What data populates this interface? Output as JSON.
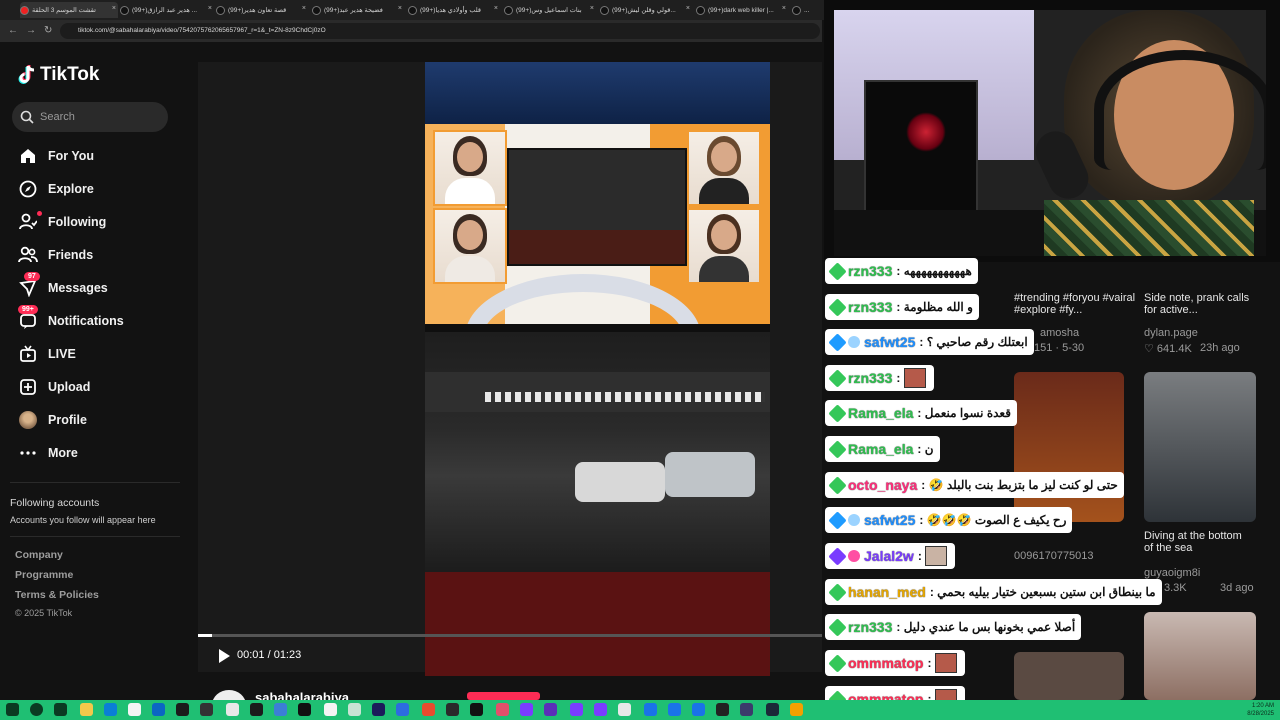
{
  "browser": {
    "tabs": [
      {
        "label": "تقشت الموسم 3 الحلقة"
      },
      {
        "label": "(99+)هدير عبد الرازق ..."
      },
      {
        "label": "(99+)قصة تعاون هدير"
      },
      {
        "label": "(99+)فضيحة هدير عبد"
      },
      {
        "label": "(99+)قلب وأولادي هديا"
      },
      {
        "label": "(99+)بنات اسماعيل وس"
      },
      {
        "label": "(99+)قولي وقلن ليش..."
      },
      {
        "label": "(99+)dark web killer |..."
      },
      {
        "label": "..."
      }
    ],
    "url": "tiktok.com/@sabahalarabiya/video/7542075762065657967_r=1&_t=ZN-8z9ChdCj0zO"
  },
  "tiktok": {
    "logo_text": "TikTok",
    "search_placeholder": "Search",
    "nav": [
      {
        "label": "For You",
        "icon": "home-icon"
      },
      {
        "label": "Explore",
        "icon": "compass-icon"
      },
      {
        "label": "Following",
        "icon": "following-icon"
      },
      {
        "label": "Friends",
        "icon": "friends-icon"
      },
      {
        "label": "Messages",
        "icon": "messages-icon",
        "badge": "97"
      },
      {
        "label": "Notifications",
        "icon": "notifications-icon",
        "badge": "99+"
      },
      {
        "label": "LIVE",
        "icon": "live-icon"
      },
      {
        "label": "Upload",
        "icon": "upload-icon"
      },
      {
        "label": "Profile",
        "icon": "profile-avatar"
      },
      {
        "label": "More",
        "icon": "more-icon"
      }
    ],
    "following_heading": "Following accounts",
    "following_sub": "Accounts you follow will appear here",
    "footer": [
      "Company",
      "Programme",
      "Terms & Policies"
    ],
    "copyright": "© 2025 TikTok",
    "player": {
      "time": "00:01 / 01:23",
      "author": "sabahalarabiya"
    }
  },
  "feed": {
    "cards": [
      {
        "title": "#trending #foryou #vairal #explore #fy...",
        "author": "amosha",
        "meta": "151 · 5-30"
      },
      {
        "title": "Side note, prank calls for active...",
        "author": "dylan.page",
        "likes": "641.4K",
        "age": "23h ago"
      },
      {
        "title": "Diving at the bottom of the sea",
        "author": "guyaoigm8i",
        "likes": "3.3K",
        "age": "3d ago"
      }
    ],
    "phone": "0096170775013"
  },
  "chat": [
    {
      "badge": "green",
      "name": "rzn333",
      "color": "#2fbf4f",
      "text": "هههههههههههه"
    },
    {
      "badge": "green",
      "name": "rzn333",
      "color": "#2fbf4f",
      "text": "و الله مظلومة"
    },
    {
      "badge": "blue",
      "name": "safwt25",
      "color": "#1e8fff",
      "text": "ابعتلك رقم صاحبي ؟"
    },
    {
      "badge": "green",
      "name": "rzn333",
      "color": "#2fbf4f",
      "text": "",
      "image": true
    },
    {
      "badge": "green",
      "name": "Rama_ela",
      "color": "#2fbf4f",
      "text": "قعدة نسوا منعمل"
    },
    {
      "badge": "green",
      "name": "Rama_ela",
      "color": "#2fbf4f",
      "text": "ن"
    },
    {
      "badge": "green",
      "name": "octo_naya",
      "color": "#ff2d7a",
      "text": "حتى لو كنت ليز ما بتزبط بنت بالبلد 🤣"
    },
    {
      "badge": "blue",
      "name": "safwt25",
      "color": "#1e8fff",
      "text": "رح يكيف ع الصوت 🤣🤣🤣"
    },
    {
      "badge": "purple",
      "name": "Jalal2w",
      "color": "#7a3cff",
      "text": "",
      "image": true
    },
    {
      "badge": "green",
      "name": "hanan_med",
      "color": "#e6a700",
      "text": "ما بينطاق ابن ستين بسبعين ختيار بيليه بحمي"
    },
    {
      "badge": "green",
      "name": "rzn333",
      "color": "#2fbf4f",
      "text": "أصلا عمي بخونها بس ما عندي دليل"
    },
    {
      "badge": "green",
      "name": "ommmatop",
      "color": "#ff2d55",
      "text": "",
      "image": true
    },
    {
      "badge": "green",
      "name": "ommmatop",
      "color": "#ff2d55",
      "text": "",
      "image": true
    }
  ],
  "taskbar": {
    "time": "1:20 AM",
    "date": "8/28/2025"
  }
}
